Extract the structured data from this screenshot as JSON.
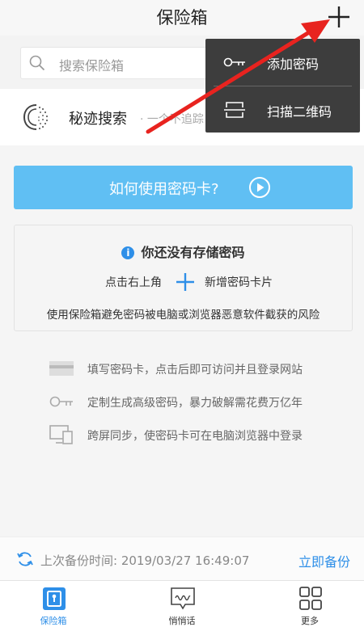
{
  "header": {
    "title": "保险箱"
  },
  "search": {
    "placeholder": "搜索保险箱"
  },
  "secret_search": {
    "title": "秘迹搜索",
    "subtitle": "· 一个不追踪"
  },
  "help": {
    "label": "如何使用密码卡?"
  },
  "empty_state": {
    "title": "你还没有存储密码",
    "hint_before": "点击右上角",
    "hint_after": "新增密码卡片",
    "description": "使用保险箱避免密码被电脑或浏览器恶意软件截获的风险"
  },
  "features": [
    {
      "icon": "card-icon",
      "text": "填写密码卡，点击后即可访问并且登录网站"
    },
    {
      "icon": "key-icon",
      "text": "定制生成高级密码，暴力破解需花费万亿年"
    },
    {
      "icon": "screen-sync-icon",
      "text": "跨屏同步，使密码卡可在电脑浏览器中登录"
    }
  ],
  "backup": {
    "text": "上次备份时间: 2019/03/27 16:49:07",
    "action": "立即备份"
  },
  "tabs": [
    {
      "label": "保险箱",
      "icon": "safe-icon",
      "active": true
    },
    {
      "label": "悄悄话",
      "icon": "chat-icon",
      "active": false
    },
    {
      "label": "更多",
      "icon": "grid-icon",
      "active": false
    }
  ],
  "popup_menu": {
    "items": [
      {
        "label": "添加密码",
        "icon": "key-icon"
      },
      {
        "label": "扫描二维码",
        "icon": "scan-icon"
      }
    ]
  },
  "colors": {
    "accent": "#2e8fe8",
    "help_button": "#60bff3",
    "popup_bg": "#3d3d3d",
    "annotation_arrow": "#e8231f"
  }
}
